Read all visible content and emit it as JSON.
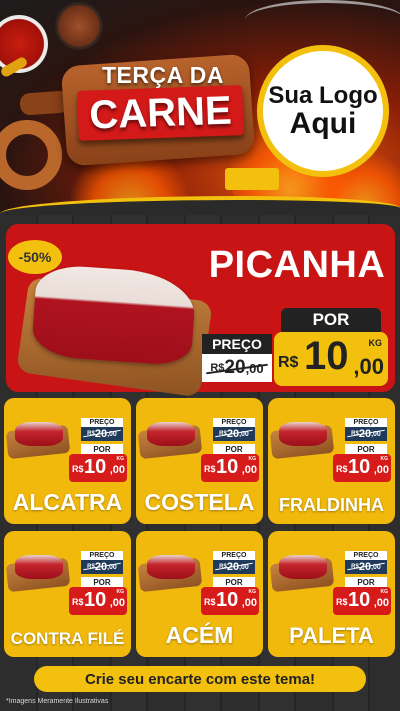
{
  "header": {
    "title_line1": "TERÇA DA",
    "title_line2": "CARNE",
    "logo_line1": "Sua Logo",
    "logo_line2": "Aqui"
  },
  "featured": {
    "discount": "-50%",
    "name": "PICANHA",
    "por_label": "POR",
    "preco_label": "PREÇO",
    "old_currency": "R$",
    "old_int": "20",
    "old_dec": ",00",
    "new_currency": "R$",
    "new_int": "10",
    "new_dec": ",00",
    "unit": "KG"
  },
  "products": [
    {
      "name": "ALCATRA",
      "preco_label": "PREÇO",
      "old_currency": "R$",
      "old_int": "20",
      "old_dec": ",00",
      "por_label": "POR",
      "new_currency": "R$",
      "new_int": "10",
      "new_dec": ",00",
      "unit": "KG"
    },
    {
      "name": "COSTELA",
      "preco_label": "PREÇO",
      "old_currency": "R$",
      "old_int": "20",
      "old_dec": ",00",
      "por_label": "POR",
      "new_currency": "R$",
      "new_int": "10",
      "new_dec": ",00",
      "unit": "KG"
    },
    {
      "name": "FRALDINHA",
      "preco_label": "PREÇO",
      "old_currency": "R$",
      "old_int": "20",
      "old_dec": ",00",
      "por_label": "POR",
      "new_currency": "R$",
      "new_int": "10",
      "new_dec": ",00",
      "unit": "KG"
    },
    {
      "name": "CONTRA FILÉ",
      "preco_label": "PREÇO",
      "old_currency": "R$",
      "old_int": "20",
      "old_dec": ",00",
      "por_label": "POR",
      "new_currency": "R$",
      "new_int": "10",
      "new_dec": ",00",
      "unit": "KG"
    },
    {
      "name": "ACÉM",
      "preco_label": "PREÇO",
      "old_currency": "R$",
      "old_int": "20",
      "old_dec": ",00",
      "por_label": "POR",
      "new_currency": "R$",
      "new_int": "10",
      "new_dec": ",00",
      "unit": "KG"
    },
    {
      "name": "PALETA",
      "preco_label": "PREÇO",
      "old_currency": "R$",
      "old_int": "20",
      "old_dec": ",00",
      "por_label": "POR",
      "new_currency": "R$",
      "new_int": "10",
      "new_dec": ",00",
      "unit": "KG"
    }
  ],
  "cta": "Crie seu encarte com este tema!",
  "footnote": "*Imagens Meramente Ilustrativas",
  "colors": {
    "red": "#c81414",
    "yellow": "#f3c10d",
    "card": "#f1b90c",
    "dark": "#222222",
    "navy": "#1f3a5a"
  }
}
